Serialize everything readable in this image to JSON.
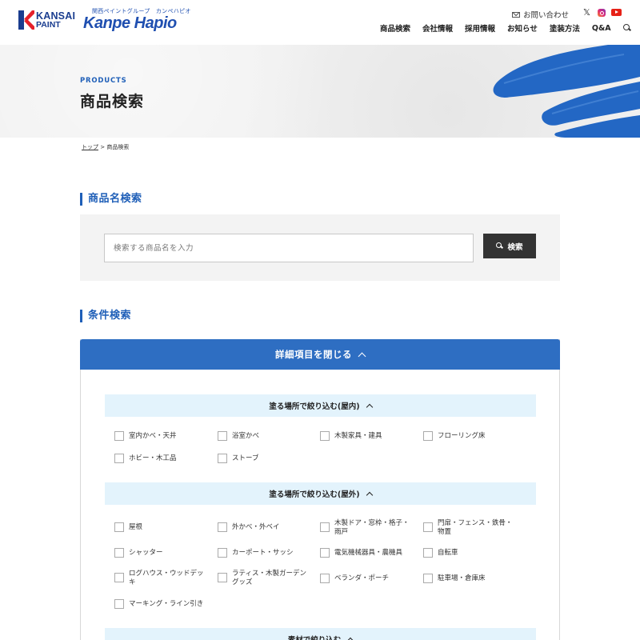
{
  "brand": {
    "kansai_line1": "KANSAI",
    "kansai_line2": "PAINT",
    "hapio_sub": "関西ペイントグループ　カンペハピオ",
    "hapio_name": "Kanpe Hapio"
  },
  "header": {
    "contact": "お問い合わせ",
    "nav": [
      "商品検索",
      "会社情報",
      "採用情報",
      "お知らせ",
      "塗装方法",
      "Q&A"
    ],
    "sns_x": "𝕏"
  },
  "hero": {
    "en": "PRODUCTS",
    "title": "商品検索"
  },
  "breadcrumb": {
    "top": "トップ",
    "sep": " > ",
    "current": "商品検索"
  },
  "name_search": {
    "heading": "商品名検索",
    "placeholder": "検索する商品名を入力",
    "button": "検索"
  },
  "cond_search": {
    "heading": "条件検索",
    "toggle": "詳細項目を閉じる",
    "groups": [
      {
        "title": "塗る場所で絞り込む(屋内)",
        "options": [
          "室内かべ・天井",
          "浴室かべ",
          "木製家具・建具",
          "フローリング床",
          "ホビー・木工品",
          "ストーブ"
        ]
      },
      {
        "title": "塗る場所で絞り込む(屋外)",
        "options": [
          "屋根",
          "外かべ・外ベイ",
          "木製ドア・窓枠・格子・雨戸",
          "門扉・フェンス・鉄骨・物置",
          "シャッター",
          "カーポート・サッシ",
          "電気機械器具・農機具",
          "自転車",
          "ログハウス・ウッドデッキ",
          "ラティス・木製ガーデングッズ",
          "ベランダ・ポーチ",
          "駐車場・倉庫床",
          "マーキング・ライン引き"
        ]
      },
      {
        "title": "素材で絞り込む"
      }
    ]
  },
  "colors": {
    "brand_blue": "#1f5fb8",
    "toggle_blue": "#2e6ec2",
    "group_bg": "#e3f3fc",
    "button_dark": "#333333"
  }
}
